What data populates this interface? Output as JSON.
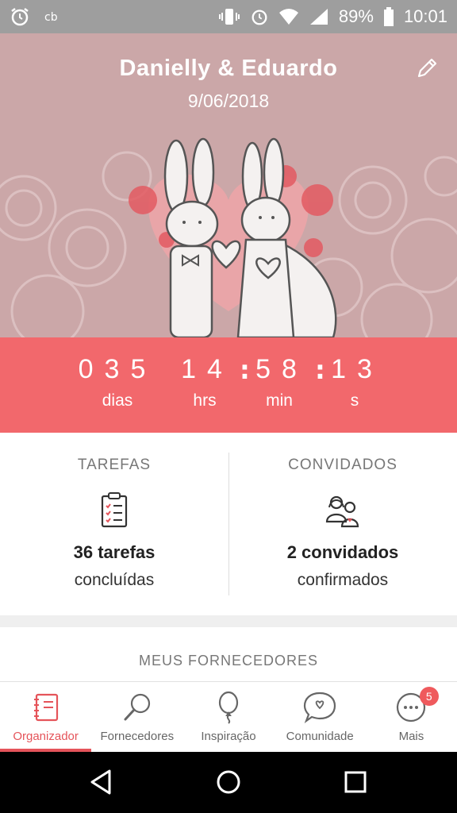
{
  "status_bar": {
    "battery": "89%",
    "time": "10:01",
    "icons": [
      "alarm-icon",
      "app-icon",
      "vibrate-icon",
      "alarm-icon",
      "wifi-icon",
      "signal-icon",
      "battery-icon"
    ]
  },
  "header": {
    "couple_names": "Danielly & Eduardo",
    "wedding_date": "9/06/2018",
    "edit_icon": "pencil-icon"
  },
  "countdown": {
    "days": "035",
    "hours": "14",
    "minutes": "58",
    "seconds": "13",
    "days_label": "dias",
    "hours_label": "hrs",
    "minutes_label": "min",
    "seconds_label": "s"
  },
  "stats": {
    "tasks": {
      "title": "TAREFAS",
      "value": "36 tarefas",
      "subtitle": "concluídas",
      "icon": "clipboard-checklist-icon"
    },
    "guests": {
      "title": "CONVIDADOS",
      "value": "2 convidados",
      "subtitle": "confirmados",
      "icon": "couple-icon"
    }
  },
  "vendors_section": {
    "title": "MEUS FORNECEDORES"
  },
  "bottom_nav": {
    "items": [
      {
        "label": "Organizador",
        "icon": "notebook-icon",
        "active": true
      },
      {
        "label": "Fornecedores",
        "icon": "magnifier-icon",
        "active": false
      },
      {
        "label": "Inspiração",
        "icon": "balloon-icon",
        "active": false
      },
      {
        "label": "Comunidade",
        "icon": "chat-heart-icon",
        "active": false
      },
      {
        "label": "Mais",
        "icon": "more-dots-icon",
        "active": false,
        "badge": "5"
      }
    ]
  },
  "colors": {
    "accent": "#f2686c",
    "header_bg": "#cba7a8",
    "active_nav": "#e5545a"
  }
}
